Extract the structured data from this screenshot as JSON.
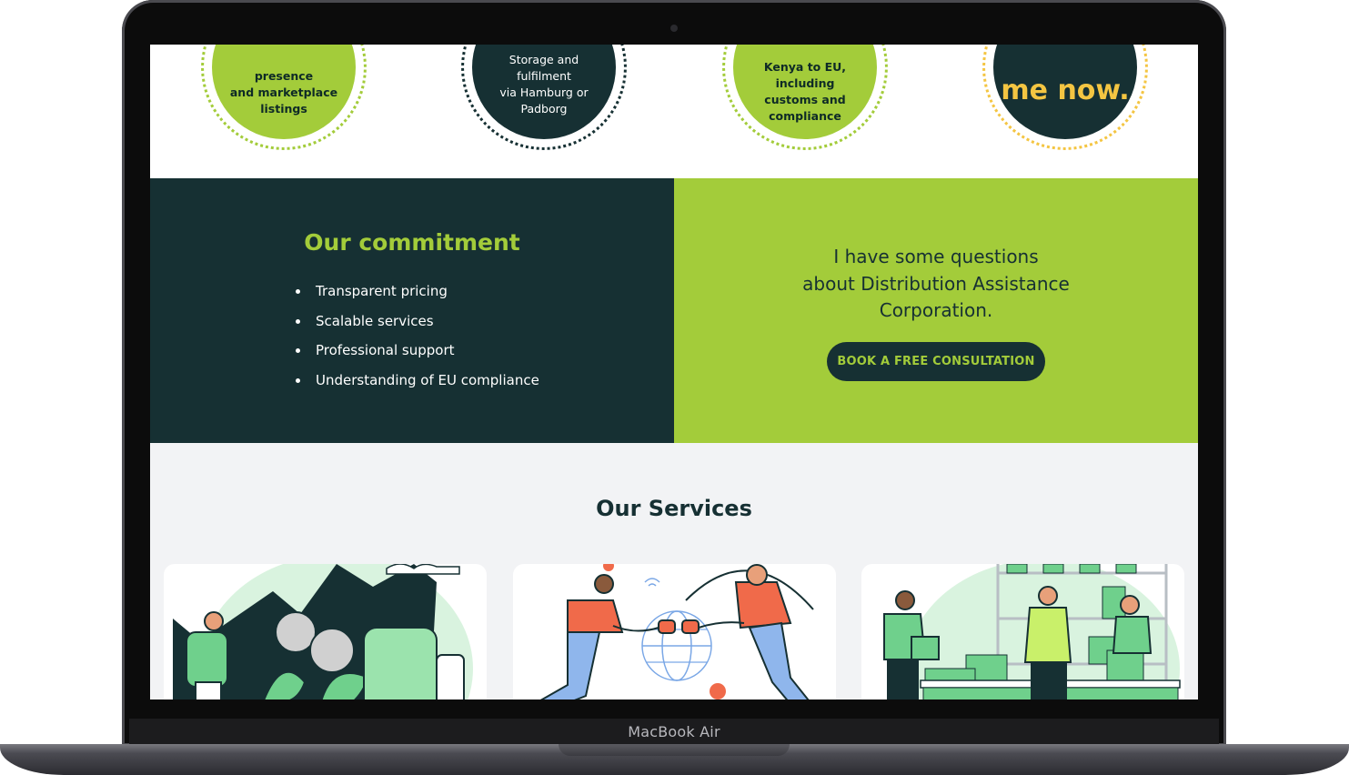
{
  "device": {
    "label": "MacBook Air"
  },
  "features": {
    "items": [
      {
        "text": "presence\nand marketplace\nlistings",
        "style": "green"
      },
      {
        "text": "Storage and fulfilment\nvia Hamburg or\nPadborg",
        "style": "dark"
      },
      {
        "text": "Kenya to EU,\nincluding\ncustoms and\ncompliance",
        "style": "green"
      },
      {
        "text": "me now.",
        "style": "yellow"
      }
    ]
  },
  "commitment": {
    "title": "Our commitment",
    "items": [
      "Transparent pricing",
      "Scalable services",
      "Professional support",
      "Understanding of EU compliance"
    ]
  },
  "question": {
    "text": "I have some questions\nabout Distribution Assistance\nCorporation.",
    "button_label": "BOOK A FREE CONSULTATION"
  },
  "services": {
    "title": "Our Services"
  },
  "colors": {
    "dark": "#163033",
    "green": "#a3cc3a",
    "yellow": "#f4c542",
    "light_bg": "#f2f3f5"
  }
}
